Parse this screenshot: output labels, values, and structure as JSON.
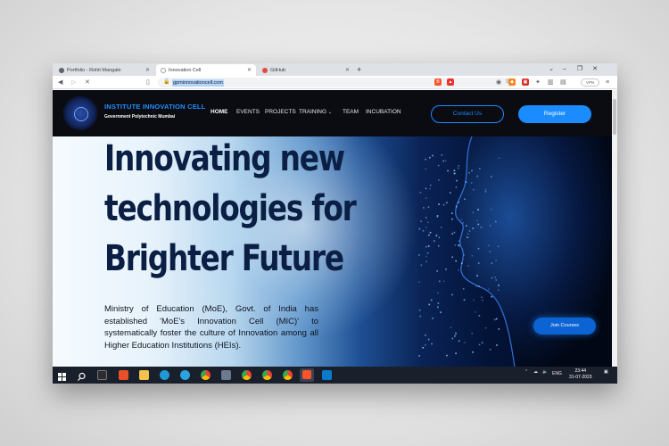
{
  "browser": {
    "tabs": [
      {
        "label": "Portfolio - Rohit Mangale",
        "active": false
      },
      {
        "label": "Innovation Cell",
        "active": true
      },
      {
        "label": "GitHub",
        "active": false
      }
    ],
    "url": "gpminnovationcell.com",
    "vpn_label": "VPN"
  },
  "site": {
    "brand_title": "INSTITUTE INNOVATION CELL",
    "brand_subtitle": "Government Polytechnic Mumbai",
    "nav": [
      "HOME",
      "EVENTS",
      "PROJECTS",
      "TRAINING",
      "TEAM",
      "INCUBATION"
    ],
    "contact_label": "Contact Us",
    "register_label": "Register",
    "headline": [
      "Innovating new",
      "technologies for",
      "Brighter Future"
    ],
    "intro": "Ministry of Education (MoE), Govt. of India has established 'MoE's Innovation Cell (MIC)' to systematically foster the culture of Innovation among all Higher Education Institutions (HEIs).",
    "courses_label": "Join Courses"
  },
  "taskbar": {
    "lang": "ENG",
    "time": "23:44",
    "date": "31-07-2023"
  },
  "colors": {
    "accent": "#1a8cff",
    "header_bg": "#0b0b12",
    "headline": "#0b1f44"
  }
}
